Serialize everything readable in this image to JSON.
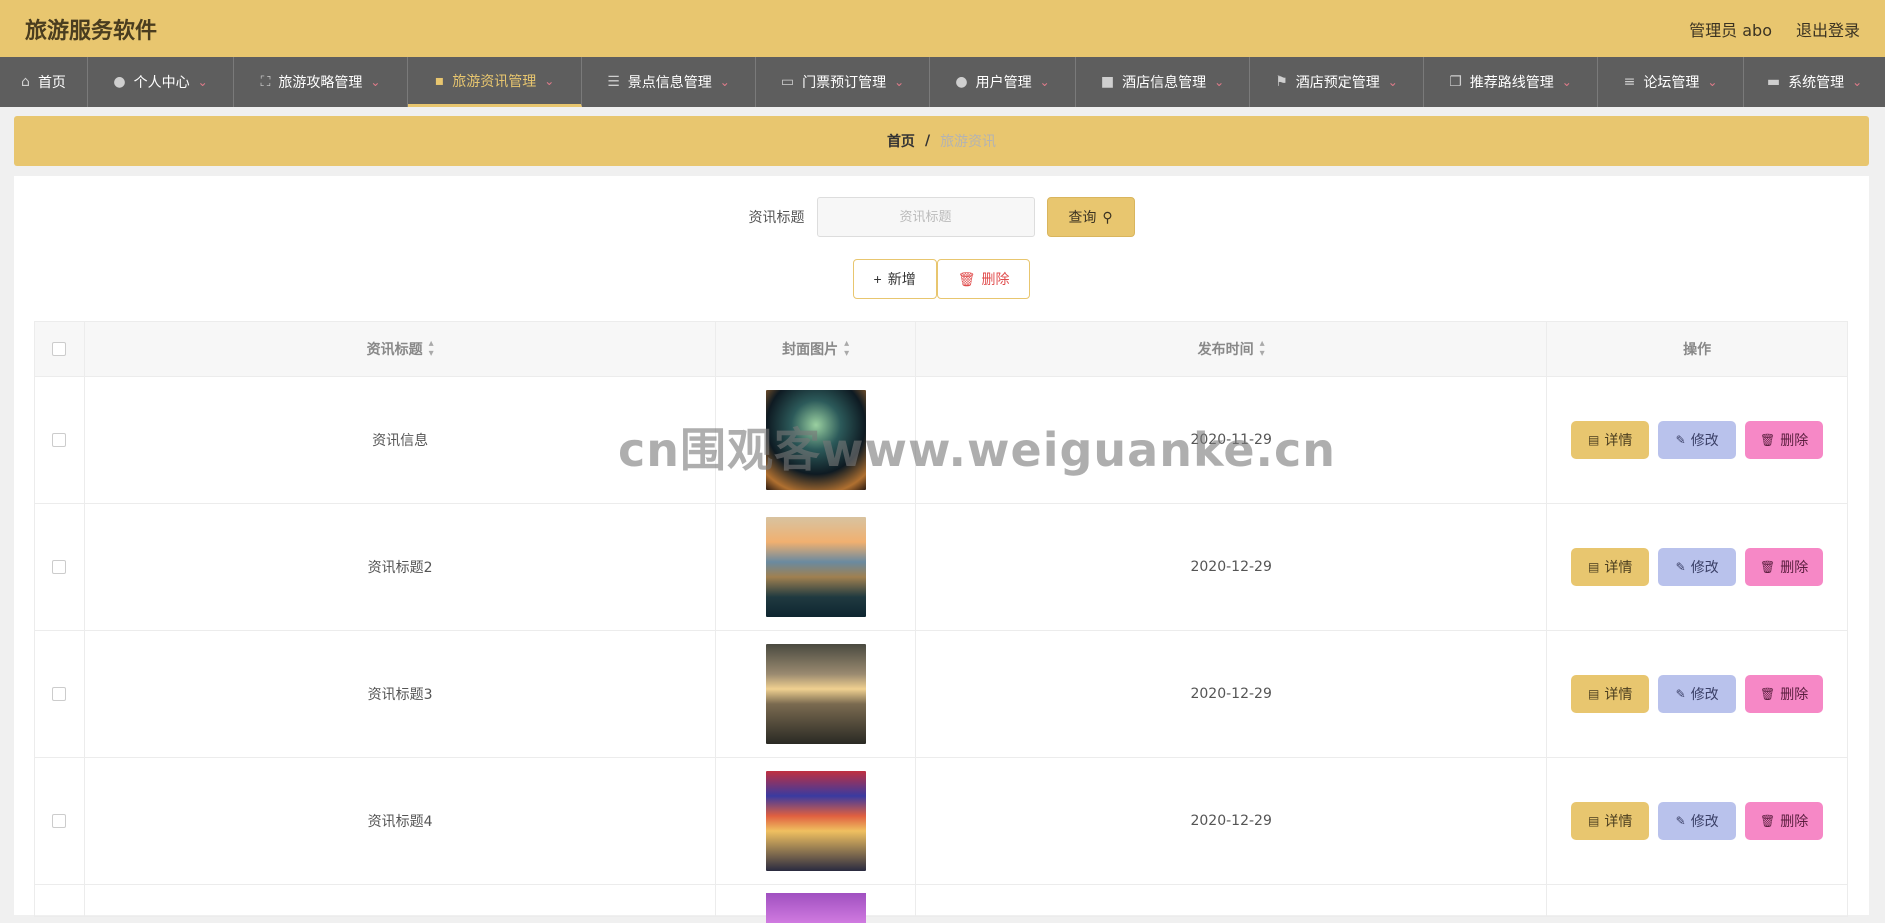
{
  "header": {
    "app_title": "旅游服务软件",
    "admin_label": "管理员 abo",
    "logout_label": "退出登录"
  },
  "nav": [
    {
      "label": "首页",
      "icon": "home-icon",
      "has_caret": false,
      "active": false
    },
    {
      "label": "个人中心",
      "icon": "user-icon",
      "has_caret": true,
      "active": false
    },
    {
      "label": "旅游攻略管理",
      "icon": "fullscreen-icon",
      "has_caret": true,
      "active": false
    },
    {
      "label": "旅游资讯管理",
      "icon": "camera-icon",
      "has_caret": true,
      "active": true
    },
    {
      "label": "景点信息管理",
      "icon": "sliders-icon",
      "has_caret": true,
      "active": false
    },
    {
      "label": "门票预订管理",
      "icon": "chat-icon",
      "has_caret": true,
      "active": false
    },
    {
      "label": "用户管理",
      "icon": "user-icon",
      "has_caret": true,
      "active": false
    },
    {
      "label": "酒店信息管理",
      "icon": "box-icon",
      "has_caret": true,
      "active": false
    },
    {
      "label": "酒店预定管理",
      "icon": "flag-icon",
      "has_caret": true,
      "active": false
    },
    {
      "label": "推荐路线管理",
      "icon": "copy-icon",
      "has_caret": true,
      "active": false
    },
    {
      "label": "论坛管理",
      "icon": "menu-icon",
      "has_caret": true,
      "active": false
    },
    {
      "label": "系统管理",
      "icon": "message-icon",
      "has_caret": true,
      "active": false
    }
  ],
  "breadcrumb": {
    "home": "首页",
    "separator": "/",
    "current": "旅游资讯"
  },
  "search": {
    "label": "资讯标题",
    "placeholder": "资讯标题",
    "value": "",
    "query_label": "查询"
  },
  "actions": {
    "add_label": "新增",
    "delete_label": "删除"
  },
  "table": {
    "headers": {
      "title": "资讯标题",
      "cover": "封面图片",
      "time": "发布时间",
      "ops": "操作"
    },
    "rows": [
      {
        "title": "资讯信息",
        "time": "2020-11-29"
      },
      {
        "title": "资讯标题2",
        "time": "2020-12-29"
      },
      {
        "title": "资讯标题3",
        "time": "2020-12-29"
      },
      {
        "title": "资讯标题4",
        "time": "2020-12-29"
      }
    ],
    "op_labels": {
      "detail": "详情",
      "edit": "修改",
      "delete": "删除"
    }
  },
  "watermark": "cn围观客www.weiguanke.cn",
  "colors": {
    "accent": "#e8c66f",
    "nav_bg": "#5e5e5e",
    "edit_btn": "#b9c2ec",
    "delete_btn": "#f688c6"
  }
}
